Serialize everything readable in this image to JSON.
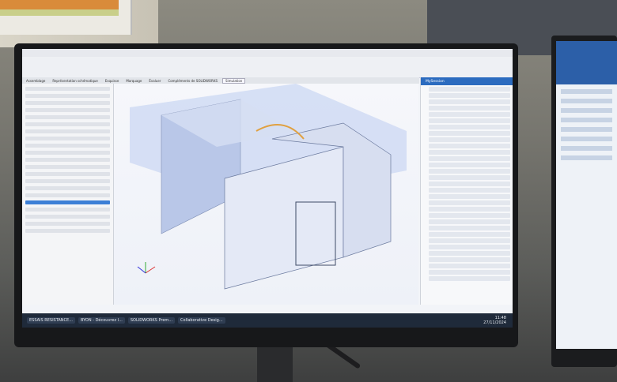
{
  "taskbar": {
    "items": [
      "ESSAIS RESISTANCE...",
      "BYON - Découvrez l...",
      "SOLIDWORKS Prem...",
      "Collaborative Desig..."
    ],
    "time": "11:48",
    "date": "27/11/2024"
  },
  "app": {
    "tabs": [
      "Assemblage",
      "Représentation schématique",
      "Esquisse",
      "Marquage",
      "Évaluer",
      "Compléments de SOLIDWORKS",
      "Simulation"
    ],
    "active_tab": "Simulation"
  },
  "right_panel": {
    "title": "MySession"
  },
  "colors": {
    "accent": "#2b6bbf",
    "taskbar": "#1f2a3a"
  }
}
